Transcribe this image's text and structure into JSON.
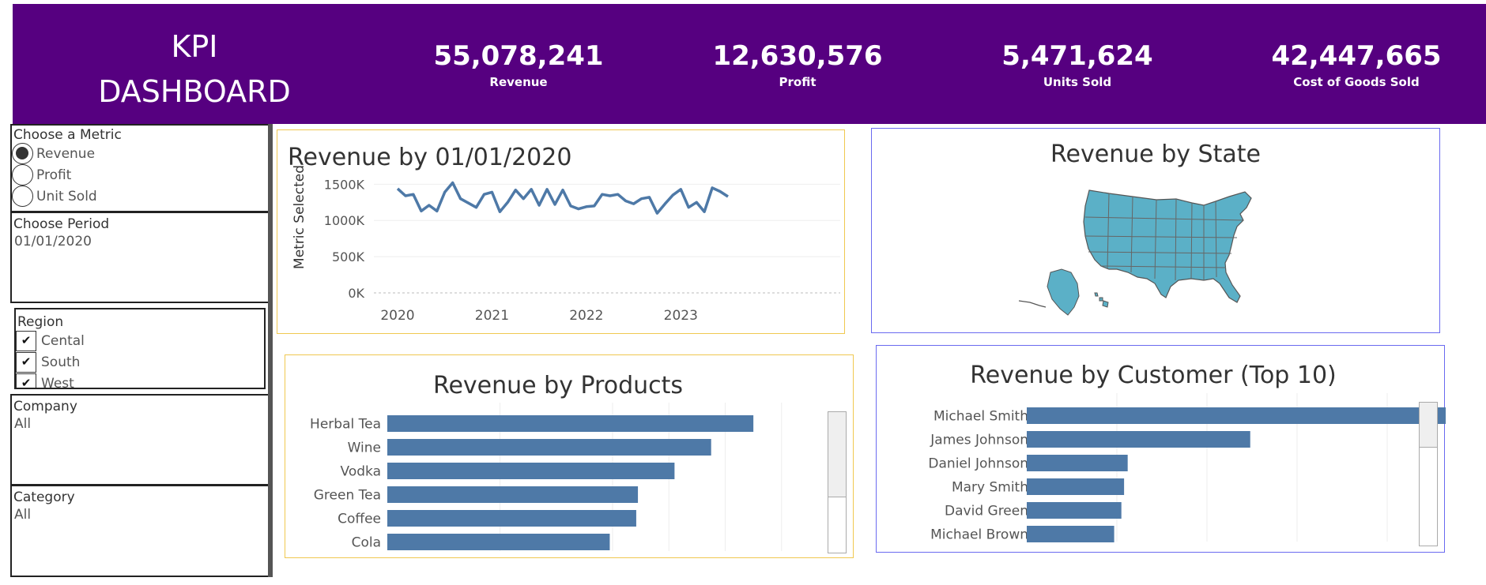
{
  "header": {
    "title_line1": "KPI",
    "title_line2": "DASHBOARD",
    "kpis": [
      {
        "value": "55,078,241",
        "label": "Revenue"
      },
      {
        "value": "12,630,576",
        "label": "Profit"
      },
      {
        "value": "5,471,624",
        "label": "Units Sold"
      },
      {
        "value": "42,447,665",
        "label": "Cost of Goods Sold"
      }
    ]
  },
  "filters": {
    "metric": {
      "title": "Choose a Metric",
      "options": [
        "Revenue",
        "Profit",
        "Unit Sold"
      ],
      "selected": "Revenue"
    },
    "period": {
      "title": "Choose Period",
      "value": "01/01/2020"
    },
    "region": {
      "title": "Region",
      "options": [
        "Cental",
        "South",
        "West"
      ]
    },
    "company": {
      "title": "Company",
      "value": "All"
    },
    "category": {
      "title": "Category",
      "value": "All"
    }
  },
  "panels": {
    "trend_title": "Revenue by 01/01/2020",
    "state_title": "Revenue by State",
    "products_title": "Revenue by Products",
    "customers_title": "Revenue by Customer (Top 10)"
  },
  "colors": {
    "header": "#560080",
    "line": "#4e79a7",
    "bar": "#4e79a7",
    "map": "#5bb0c7",
    "gold_border": "#f0c850",
    "blue_border": "#6a6af0"
  },
  "chart_data": [
    {
      "type": "line",
      "title": "Revenue by 01/01/2020",
      "ylabel": "Metric Selected",
      "xlabel": "",
      "x_ticks": [
        "2020",
        "2021",
        "2022",
        "2023"
      ],
      "y_ticks": [
        "0K",
        "500K",
        "1000K",
        "1500K"
      ],
      "ylim": [
        0,
        1700
      ],
      "x": [
        "2020-01",
        "2020-02",
        "2020-03",
        "2020-04",
        "2020-05",
        "2020-06",
        "2020-07",
        "2020-08",
        "2020-09",
        "2020-10",
        "2020-11",
        "2020-12",
        "2021-01",
        "2021-02",
        "2021-03",
        "2021-04",
        "2021-05",
        "2021-06",
        "2021-07",
        "2021-08",
        "2021-09",
        "2021-10",
        "2021-11",
        "2021-12",
        "2022-01",
        "2022-02",
        "2022-03",
        "2022-04",
        "2022-05",
        "2022-06",
        "2022-07",
        "2022-08",
        "2022-09",
        "2022-10",
        "2022-11",
        "2022-12",
        "2023-01",
        "2023-02",
        "2023-03",
        "2023-04",
        "2023-05",
        "2023-06",
        "2023-07"
      ],
      "values": [
        1440,
        1340,
        1360,
        1130,
        1210,
        1130,
        1390,
        1520,
        1300,
        1240,
        1180,
        1360,
        1390,
        1120,
        1250,
        1420,
        1300,
        1430,
        1210,
        1430,
        1220,
        1420,
        1200,
        1160,
        1190,
        1200,
        1360,
        1340,
        1360,
        1270,
        1230,
        1300,
        1320,
        1100,
        1230,
        1350,
        1430,
        1180,
        1250,
        1120,
        1450,
        1400,
        1330
      ],
      "series_name": "",
      "grid": true
    },
    {
      "type": "bar",
      "orientation": "horizontal",
      "title": "Revenue by Products",
      "categories": [
        "Herbal Tea",
        "Wine",
        "Vodka",
        "Green Tea",
        "Coffee",
        "Cola"
      ],
      "values": [
        6.5,
        5.75,
        5.1,
        4.45,
        4.42,
        3.95
      ],
      "xlim": [
        0,
        7.2
      ],
      "grid": true
    },
    {
      "type": "bar",
      "orientation": "horizontal",
      "title": "Revenue by Customer (Top 10)",
      "categories": [
        "Michael Smith",
        "James Johnson",
        "Daniel Johnson",
        "Mary Smith",
        "David Green",
        "Michael Brown"
      ],
      "values": [
        4.7,
        2.48,
        1.12,
        1.08,
        1.05,
        0.97
      ],
      "xlim": [
        0,
        5.0
      ],
      "grid": true
    }
  ]
}
